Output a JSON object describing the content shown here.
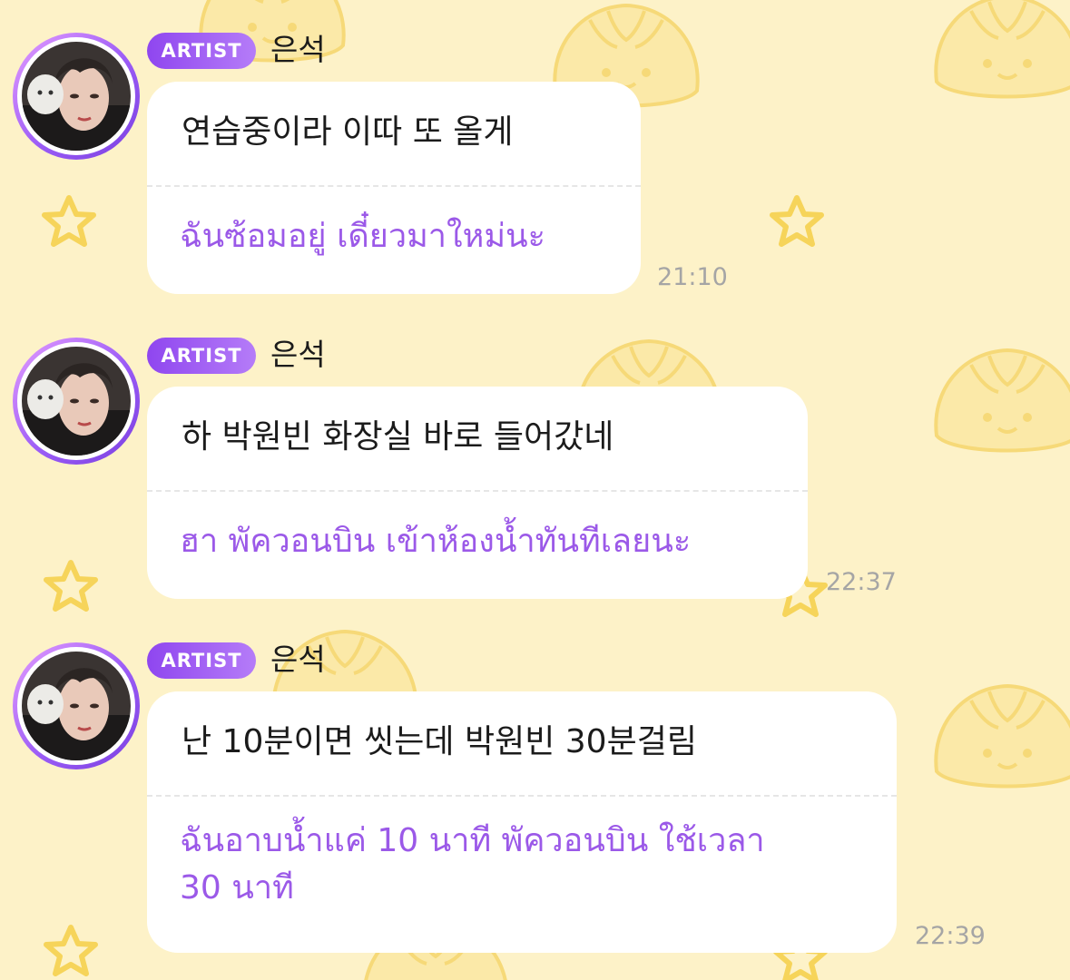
{
  "messages": [
    {
      "badge": "ARTIST",
      "sender": "은석",
      "text": "연습중이라 이따 또 올게",
      "translation": "ฉันซ้อมอยู่ เดี๋ยวมาใหม่นะ",
      "time": "21:10"
    },
    {
      "badge": "ARTIST",
      "sender": "은석",
      "text": "하 박원빈 화장실 바로 들어갔네",
      "translation": "ฮา พัควอนบิน เข้าห้องน้ำทันทีเลยนะ",
      "time": "22:37"
    },
    {
      "badge": "ARTIST",
      "sender": "은석",
      "text": "난 10분이면 씻는데 박원빈 30분걸림",
      "translation_lines": [
        "ฉันอาบน้ำแค่ 10 นาที พัควอนบิน ใช้เวลา",
        "30 นาที"
      ],
      "time": "22:39"
    }
  ],
  "colors": {
    "background": "#fdf2c8",
    "badge_gradient": [
      "#8f46ef",
      "#b57cf8"
    ],
    "translation_text": "#9b59e8",
    "timestamp": "#a5a5a5",
    "bubble": "#ffffff",
    "decoration": "#f8e08a"
  },
  "icons": {
    "background_pattern": [
      "dumpling-icon",
      "star-icon"
    ],
    "avatar": "user-avatar-photo"
  }
}
